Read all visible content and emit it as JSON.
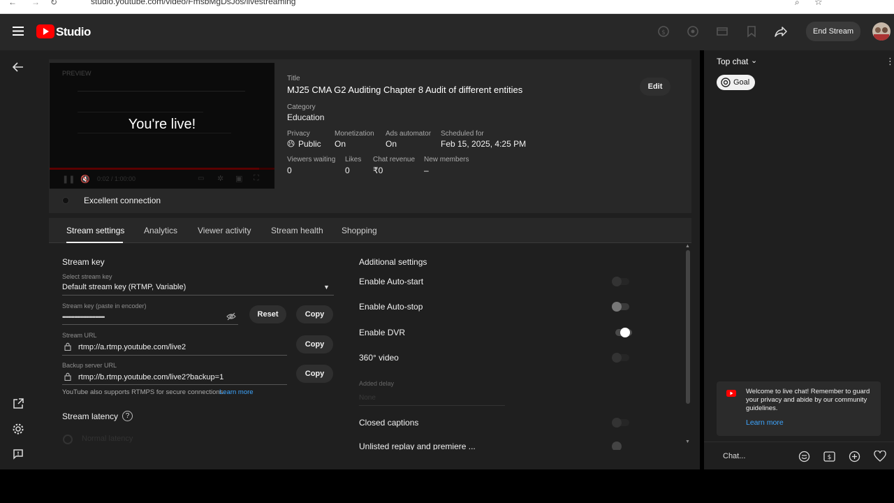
{
  "browser": {
    "url": "studio.youtube.com/video/FmsbMgDsJos/livestreaming"
  },
  "header": {
    "logo_text": "Studio",
    "end_stream_label": "End Stream"
  },
  "preview": {
    "badge": "PREVIEW",
    "live_text": "You're live!",
    "time": "0:02 / 1:00:00",
    "connection": "Excellent connection"
  },
  "stream_info": {
    "title_label": "Title",
    "title": "MJ25 CMA G2 Auditing Chapter 8 Audit of different entities",
    "edit_label": "Edit",
    "category_label": "Category",
    "category": "Education",
    "privacy_label": "Privacy",
    "privacy": "Public",
    "monetization_label": "Monetization",
    "monetization": "On",
    "ads_label": "Ads automator",
    "ads": "On",
    "scheduled_label": "Scheduled for",
    "scheduled": "Feb 15, 2025, 4:25 PM",
    "viewers_label": "Viewers waiting",
    "viewers": "0",
    "likes_label": "Likes",
    "likes": "0",
    "revenue_label": "Chat revenue",
    "revenue": "₹0",
    "members_label": "New members",
    "members": "–"
  },
  "tabs": [
    "Stream settings",
    "Analytics",
    "Viewer activity",
    "Stream health",
    "Shopping"
  ],
  "stream_key": {
    "section": "Stream key",
    "select_label": "Select stream key",
    "selected": "Default stream key (RTMP, Variable)",
    "key_label": "Stream key (paste in encoder)",
    "key_mask": "••••••••••••••••••••••••••••",
    "reset_label": "Reset",
    "copy_label": "Copy",
    "url_label": "Stream URL",
    "url": "rtmp://a.rtmp.youtube.com/live2",
    "backup_label": "Backup server URL",
    "backup": "rtmp://b.rtmp.youtube.com/live2?backup=1",
    "rtmps_note": "YouTube also supports RTMPS for secure connections.",
    "learn_more": "Learn more",
    "latency_title": "Stream latency",
    "latency_option": "Normal latency"
  },
  "additional": {
    "section": "Additional settings",
    "auto_start": "Enable Auto-start",
    "auto_stop": "Enable Auto-stop",
    "dvr": "Enable DVR",
    "video360": "360° video",
    "delay_label": "Added delay",
    "delay_value": "None",
    "captions": "Closed captions",
    "cutoff": "Unlisted replay and premiere ..."
  },
  "chat": {
    "top_chat": "Top chat",
    "goal": "Goal",
    "welcome": "Welcome to live chat! Remember to guard your privacy and abide by our community guidelines.",
    "learn_more": "Learn more",
    "input_placeholder": "Chat..."
  },
  "colors": {
    "youtube_red": "#ff0000",
    "link_blue": "#3ea6ff",
    "background": "#1f1f1f"
  }
}
